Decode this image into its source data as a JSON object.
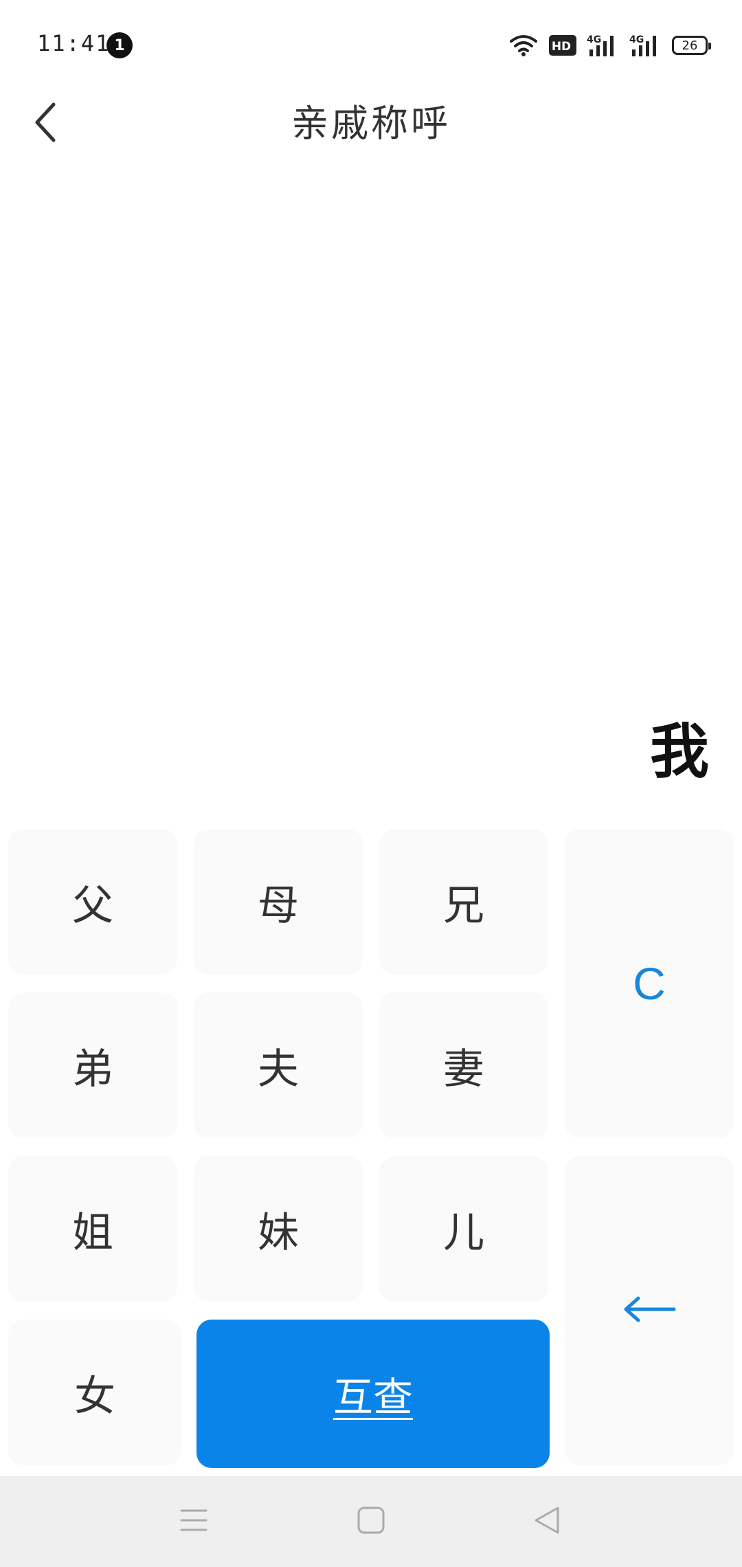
{
  "status_bar": {
    "time": "11:41",
    "notification_count": "1",
    "hd_label": "HD",
    "network_1": "4G",
    "network_2": "4G",
    "battery_level": "26"
  },
  "header": {
    "title": "亲戚称呼",
    "back_icon": "chevron-left-icon"
  },
  "display": {
    "text": "我"
  },
  "keypad": {
    "keys": {
      "father": "父",
      "mother": "母",
      "elder_brother": "兄",
      "younger_brother": "弟",
      "husband": "夫",
      "wife": "妻",
      "elder_sister": "姐",
      "younger_sister": "妹",
      "son": "儿",
      "daughter": "女"
    },
    "clear_label": "C",
    "backspace_label": "←",
    "query_label": "互查"
  },
  "nav_bar": {
    "menu_icon": "menu-icon",
    "home_icon": "home-square-icon",
    "back_icon": "back-triangle-icon"
  },
  "colors": {
    "accent": "#0a84e8",
    "action_text": "#1a86d9",
    "key_background": "#fafafa",
    "nav_background": "#efefef"
  }
}
